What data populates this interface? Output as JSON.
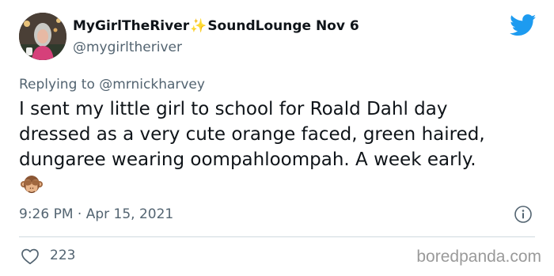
{
  "author": {
    "display_name_part1": "MyGirlTheRiver",
    "display_name_sparkle": "✨",
    "display_name_part2": "SoundLounge",
    "date": "Nov 6",
    "handle": "@mygirltheriver",
    "avatar_icon": "avatar-photo"
  },
  "brand_icon": "twitter-bird-icon",
  "brand_color": "#1d9bf0",
  "reply": {
    "prefix": "Replying to",
    "handle": "@mrnickharvey"
  },
  "tweet": {
    "lines": [
      "I sent my little girl to school for Roald  Dahl day",
      "dressed as a very cute orange faced, green haired,",
      "dungaree wearing oompahloompah. A week early."
    ],
    "emoji": "see-no-evil-monkey"
  },
  "meta": {
    "time": "9:26 PM",
    "separator": "·",
    "date": "Apr 15, 2021",
    "info_icon": "info-icon"
  },
  "actions": {
    "like_icon": "heart-icon",
    "like_count": "223"
  },
  "watermark": "boredpanda.com"
}
